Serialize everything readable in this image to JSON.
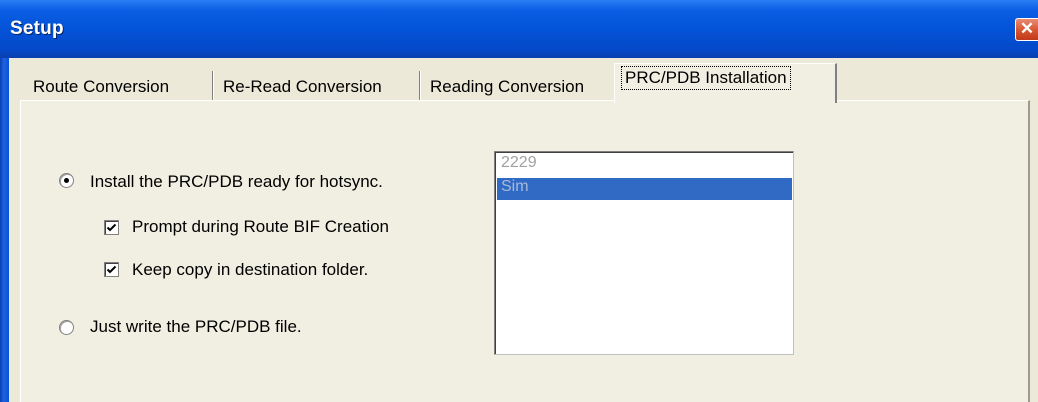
{
  "window": {
    "title": "Setup",
    "close_glyph": "✕"
  },
  "tabs": [
    {
      "label": "Route Conversion",
      "active": false
    },
    {
      "label": "Re-Read Conversion",
      "active": false
    },
    {
      "label": "Reading Conversion",
      "active": false
    },
    {
      "label": "PRC/PDB Installation",
      "active": true
    }
  ],
  "options": {
    "install_radio": {
      "label": "Install the PRC/PDB ready for hotsync.",
      "selected": true
    },
    "prompt_checkbox": {
      "label": "Prompt during Route BIF Creation",
      "checked": true
    },
    "keep_copy_checkbox": {
      "label": "Keep copy in destination folder.",
      "checked": true
    },
    "write_radio": {
      "label": "Just write the PRC/PDB file.",
      "selected": false
    }
  },
  "user_list": {
    "items": [
      {
        "label": "2229",
        "state": "disabled"
      },
      {
        "label": "Sim",
        "state": "selected"
      }
    ]
  },
  "colors": {
    "titlebar": "#0453d8",
    "selection": "#316ac5",
    "dialog_bg": "#ece9d8"
  },
  "icons": [
    "close-icon",
    "radio-selected-icon",
    "radio-unselected-icon",
    "checkmark-icon"
  ]
}
